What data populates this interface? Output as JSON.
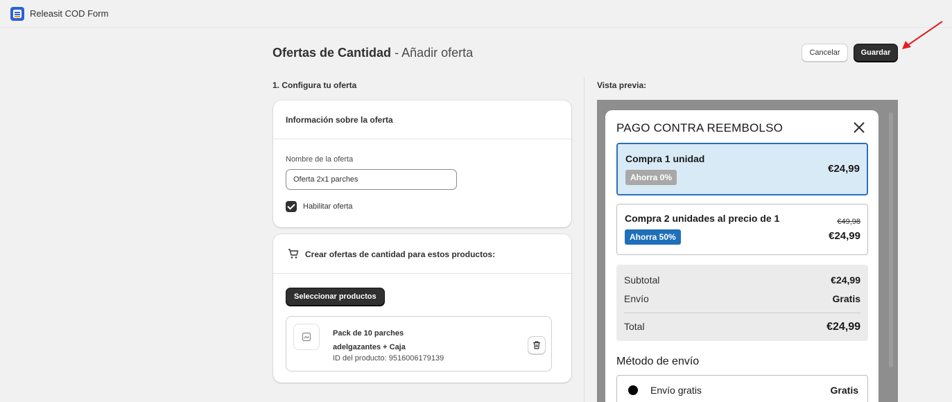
{
  "app": {
    "title": "Releasit COD Form"
  },
  "header": {
    "title_main": "Ofertas de Cantidad",
    "title_sub": "- Añadir oferta",
    "cancel_label": "Cancelar",
    "save_label": "Guardar"
  },
  "config": {
    "section_label": "1. Configura tu oferta",
    "info_card": {
      "title": "Información sobre la oferta",
      "name_label": "Nombre de la oferta",
      "name_value": "Oferta 2x1 parches",
      "enable_label": "Habilitar oferta",
      "enabled": true
    },
    "products_card": {
      "title": "Crear ofertas de cantidad para estos productos:",
      "select_label": "Seleccionar productos",
      "product": {
        "name_line1": "Pack de 10 parches",
        "name_line2": "adelgazantes + Caja",
        "id_text": "ID del producto: 9516006179139"
      }
    }
  },
  "preview": {
    "section_label": "Vista previa:",
    "modal_title": "PAGO CONTRA REEMBOLSO",
    "offers": [
      {
        "title": "Compra 1 unidad",
        "badge": "Ahorra 0%",
        "price": "€24,99",
        "selected": true
      },
      {
        "title": "Compra 2 unidades al precio de 1",
        "badge": "Ahorra 50%",
        "old_price": "€49,98",
        "price": "€24,99",
        "selected": false
      }
    ],
    "summary": {
      "subtotal_label": "Subtotal",
      "subtotal_value": "€24,99",
      "shipping_label": "Envío",
      "shipping_value": "Gratis",
      "total_label": "Total",
      "total_value": "€24,99"
    },
    "shipping_method": {
      "title": "Método de envío",
      "option_label": "Envío gratis",
      "option_value": "Gratis"
    }
  },
  "colors": {
    "primary_button": "#303030",
    "selected_offer_bg": "#d9eaf7",
    "selected_offer_border": "#2a6ebb",
    "badge_blue": "#1f6fba",
    "annotation_arrow": "#e02020"
  }
}
